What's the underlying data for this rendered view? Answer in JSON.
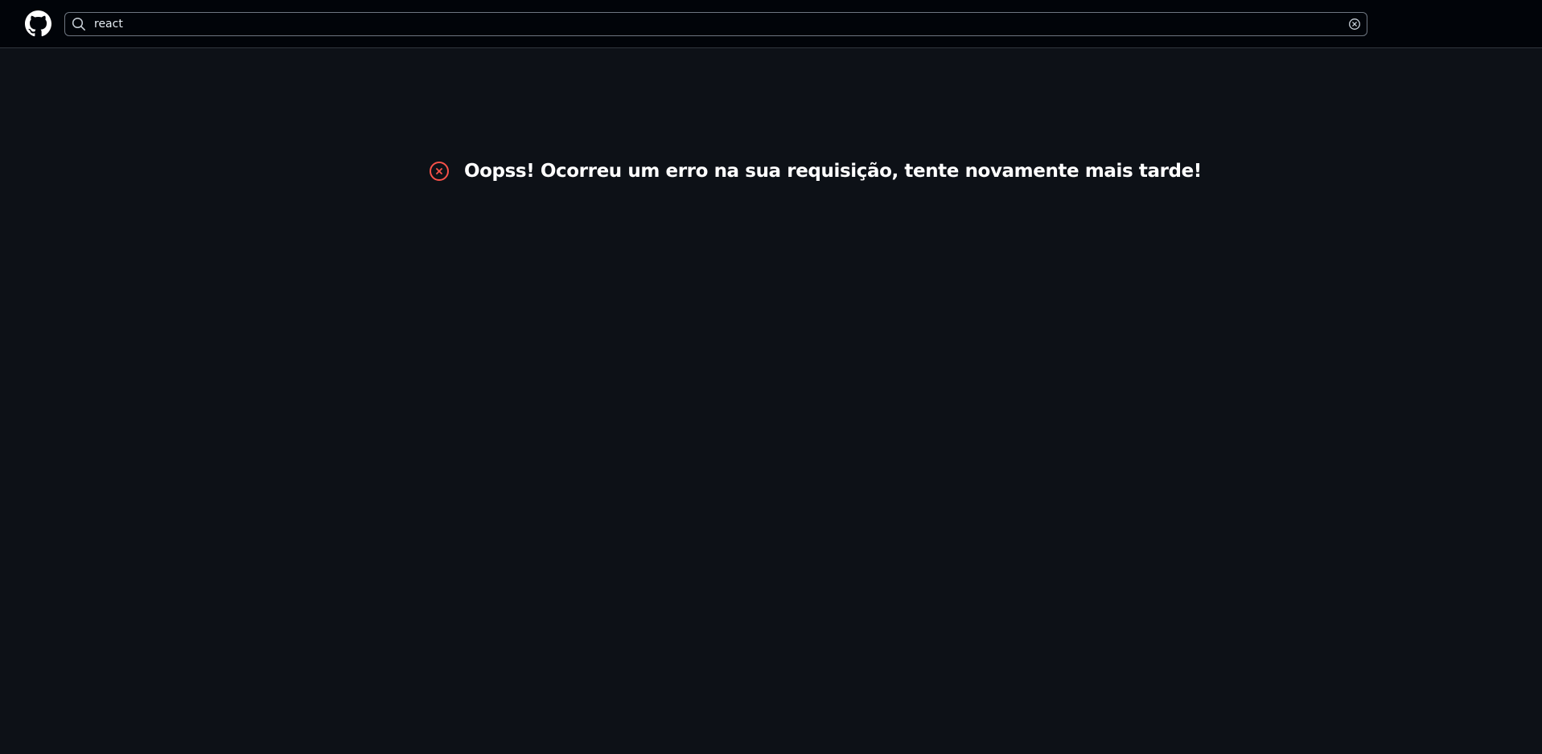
{
  "header": {
    "logo_icon": "github-icon",
    "search": {
      "value": "react",
      "placeholder": "",
      "search_icon": "search-icon",
      "clear_icon": "clear-circle-icon"
    }
  },
  "main": {
    "error": {
      "icon": "x-circle-icon",
      "message": "Oopss! Ocorreu um erro na sua requisição, tente novamente mais tarde!",
      "icon_color": "#f85149"
    }
  },
  "colors": {
    "background": "#0d1117",
    "header_background": "#010409",
    "text": "#ffffff"
  }
}
